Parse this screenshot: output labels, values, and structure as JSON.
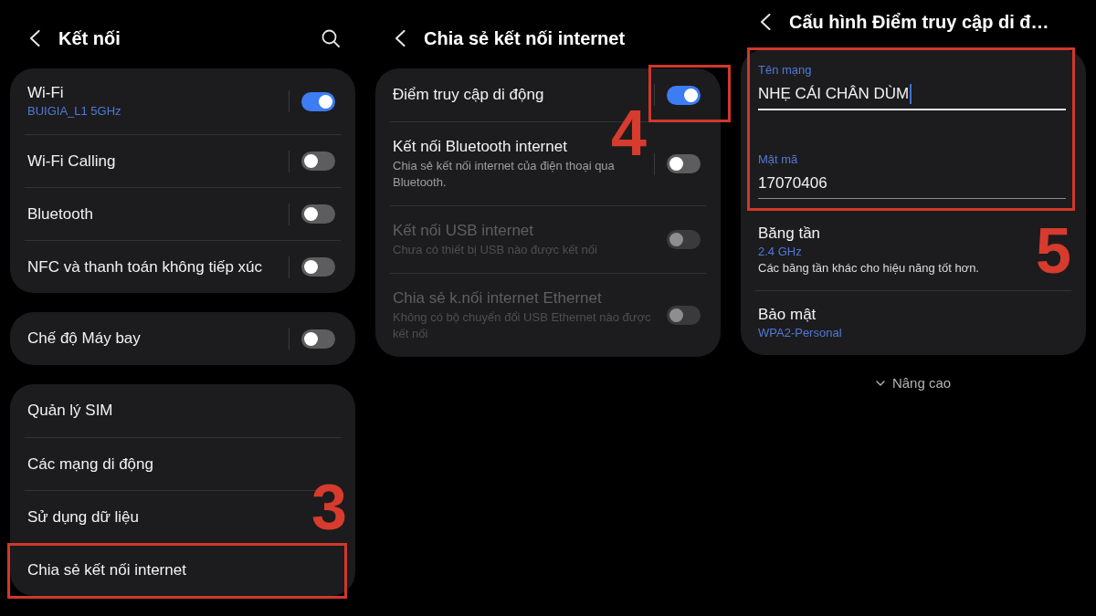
{
  "screens": [
    {
      "title": "Kết nối",
      "search_button": true,
      "groups": [
        {
          "rows": [
            {
              "kind": "toggle",
              "label": "Wi-Fi",
              "value": "BUIGIA_L1 5GHz",
              "on": true,
              "disabled": false,
              "highlighted": false
            },
            {
              "kind": "toggle",
              "label": "Wi-Fi Calling",
              "on": false,
              "disabled": false,
              "highlighted": false
            },
            {
              "kind": "toggle",
              "label": "Bluetooth",
              "on": false,
              "disabled": false,
              "highlighted": false
            },
            {
              "kind": "toggle",
              "label": "NFC và thanh toán không tiếp xúc",
              "on": false,
              "disabled": false,
              "highlighted": false
            }
          ]
        },
        {
          "rows": [
            {
              "kind": "toggle",
              "label": "Chế độ Máy bay",
              "on": false,
              "disabled": false,
              "highlighted": false
            }
          ]
        },
        {
          "rows": [
            {
              "kind": "link",
              "label": "Quản lý SIM",
              "highlighted": false
            },
            {
              "kind": "link",
              "label": "Các mạng di động",
              "highlighted": false
            },
            {
              "kind": "link",
              "label": "Sử dụng dữ liệu",
              "highlighted": false,
              "step": "3"
            },
            {
              "kind": "link",
              "label": "Chia sẻ kết nối internet",
              "highlighted": true
            }
          ]
        }
      ]
    },
    {
      "title": "Chia sẻ kết nối internet",
      "groups": [
        {
          "rows": [
            {
              "kind": "toggle",
              "label": "Điểm truy cập di động",
              "on": true,
              "disabled": false,
              "highlighted": true
            },
            {
              "kind": "toggle",
              "label": "Kết nối Bluetooth internet",
              "description": "Chia sẻ kết nối internet của điện thoại qua Bluetooth.",
              "on": false,
              "disabled": false,
              "highlighted": false,
              "step": "4"
            },
            {
              "kind": "toggle",
              "label": "Kết nối USB internet",
              "description": "Chưa có thiết bị USB nào được kết nối",
              "on": false,
              "disabled": true,
              "highlighted": false
            },
            {
              "kind": "toggle",
              "label": "Chia sẻ k.nối internet Ethernet",
              "description": "Không có bộ chuyển đổi USB Ethernet nào được kết nối",
              "on": false,
              "disabled": true,
              "highlighted": false
            }
          ]
        }
      ]
    },
    {
      "title": "Cấu hình Điểm truy cập di đ…",
      "groups": [
        {
          "fields_highlighted": true,
          "fields": [
            {
              "label": "Tên mạng",
              "value": "NHẸ CÁI CHÂN DÙM",
              "focused": true
            },
            {
              "label": "Mật mã",
              "value": "17070406",
              "focused": false
            }
          ],
          "rows": [
            {
              "kind": "select",
              "label": "Băng tần",
              "value": "2.4 GHz",
              "description": "Các băng tần khác cho hiệu năng tốt hơn.",
              "highlighted": false,
              "step": "5"
            },
            {
              "kind": "select",
              "label": "Bảo mật",
              "value": "WPA2-Personal",
              "highlighted": false
            }
          ]
        }
      ],
      "more_button": "Nâng cao"
    }
  ]
}
